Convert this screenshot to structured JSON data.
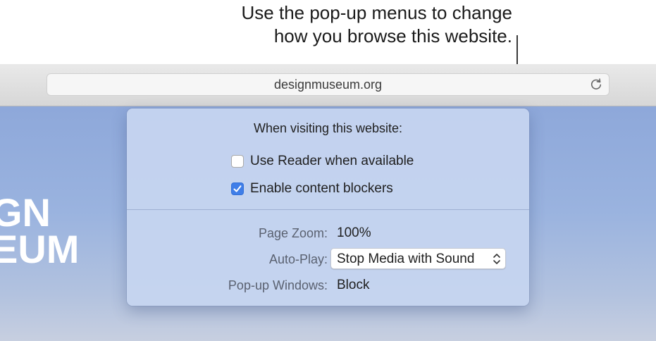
{
  "callout": {
    "line1": "Use the pop-up menus to change",
    "line2": "how you browse this website."
  },
  "address_bar": {
    "url": "designmuseum.org"
  },
  "website": {
    "logo_line1": "GN",
    "logo_line2": "EUM"
  },
  "popover": {
    "heading": "When visiting this website:",
    "checkboxes": [
      {
        "label": "Use Reader when available",
        "checked": false
      },
      {
        "label": "Enable content blockers",
        "checked": true
      }
    ],
    "settings": {
      "page_zoom": {
        "label": "Page Zoom:",
        "value": "100%"
      },
      "auto_play": {
        "label": "Auto-Play:",
        "value": "Stop Media with Sound"
      },
      "popup_windows": {
        "label": "Pop-up Windows:",
        "value": "Block"
      }
    }
  },
  "colors": {
    "accent": "#3f7ee8",
    "popover_bg": "#c6d4f0",
    "website_sky": "#9ab3df"
  },
  "icons": [
    "reload-icon",
    "checkmark-icon",
    "chevron-updown-icon"
  ]
}
